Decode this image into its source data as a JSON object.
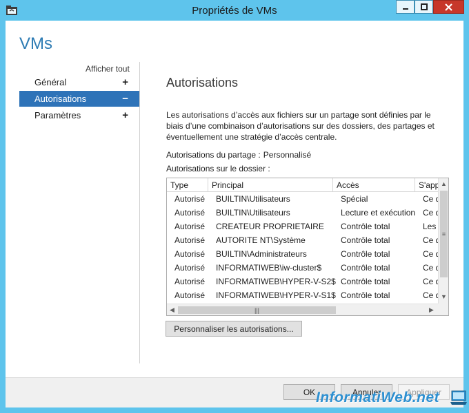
{
  "window": {
    "title": "Propriétés de VMs"
  },
  "app_title": "VMs",
  "sidebar": {
    "show_all": "Afficher tout",
    "items": [
      {
        "label": "Général",
        "sign": "+"
      },
      {
        "label": "Autorisations",
        "sign": "−"
      },
      {
        "label": "Paramètres",
        "sign": "+"
      }
    ]
  },
  "main": {
    "section_title": "Autorisations",
    "description": "Les autorisations d’accès aux fichiers sur un partage sont définies par le biais d’une combinaison d’autorisations sur des dossiers, des partages et éventuellement une stratégie d’accès centrale.",
    "share_permissions_label": "Autorisations du partage :",
    "share_permissions_value": "Personnalisé",
    "folder_permissions_label": "Autorisations sur le dossier :",
    "table": {
      "columns": [
        "Type",
        "Principal",
        "Accès",
        "S'appliq"
      ],
      "rows": [
        {
          "type": "Autorisé",
          "principal": "BUILTIN\\Utilisateurs",
          "access": "Spécial",
          "applies": "Ce dossier"
        },
        {
          "type": "Autorisé",
          "principal": "BUILTIN\\Utilisateurs",
          "access": "Lecture et exécution",
          "applies": "Ce dossier"
        },
        {
          "type": "Autorisé",
          "principal": "CREATEUR PROPRIETAIRE",
          "access": "Contrôle total",
          "applies": "Les sous-dossiers"
        },
        {
          "type": "Autorisé",
          "principal": "AUTORITE NT\\Système",
          "access": "Contrôle total",
          "applies": "Ce dossier"
        },
        {
          "type": "Autorisé",
          "principal": "BUILTIN\\Administrateurs",
          "access": "Contrôle total",
          "applies": "Ce dossier"
        },
        {
          "type": "Autorisé",
          "principal": "INFORMATIWEB\\iw-cluster$",
          "access": "Contrôle total",
          "applies": "Ce dossier"
        },
        {
          "type": "Autorisé",
          "principal": "INFORMATIWEB\\HYPER-V-S2$",
          "access": "Contrôle total",
          "applies": "Ce dossier"
        },
        {
          "type": "Autorisé",
          "principal": "INFORMATIWEB\\HYPER-V-S1$",
          "access": "Contrôle total",
          "applies": "Ce dossier"
        }
      ]
    },
    "customize_button": "Personnaliser les autorisations..."
  },
  "footer": {
    "ok": "OK",
    "cancel": "Annuler",
    "apply": "Appliquer"
  },
  "watermark": "InformatiWeb.net",
  "colors": {
    "titlebar": "#5ec4ec",
    "selection": "#2e73b8",
    "app_title": "#2d7bb3",
    "close": "#c7372a"
  }
}
